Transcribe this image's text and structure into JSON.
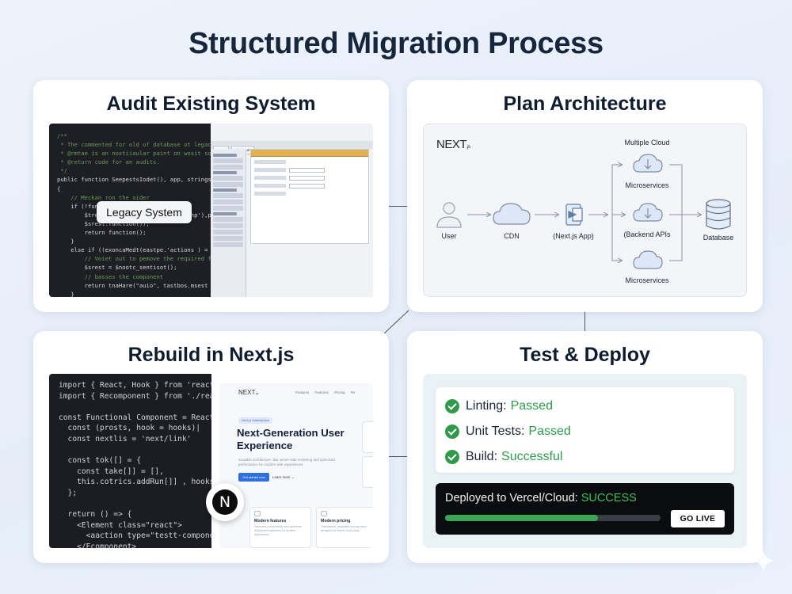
{
  "title": "Structured Migration Process",
  "panels": {
    "audit": {
      "title": "Audit Existing System",
      "code_lines": [
        "/**",
        " * The commented for old of database ot legac",
        " * @rmtae is an noxtiiaular paint on wosit sod",
        " * @return code for an audits.",
        " */",
        "public function SeepestsIodet(), app, stringst",
        "{",
        "    // Meckan ron the oider",
        "    if (!functions+$ontote')) {",
        "        $trest = $ceset_aadocese('sat_php'),pe",
        "        $srest.function());",
        "        return function();",
        "    }",
        "    else if ((exoncaMedt(eastpe.'actions ) =",
        "        // Voiet out to pemove the required fo",
        "        $srest = $nootc_sentisot();",
        "        // basses the component",
        "        return tnaHare(\"auio\", tastbos.msest",
        "    }",
        "}"
      ],
      "legacy_tabs": [
        "Home",
        "Dirsiceum"
      ],
      "legacy_label": "Legacy System"
    },
    "plan": {
      "title": "Plan Architecture",
      "logo": "NEXT",
      "logo_suffix": ".js",
      "nodes": {
        "user": "User",
        "cdn": "CDN",
        "app": "(Next.js App)",
        "cloud_group": "Multiple Cloud",
        "ms_top": "Microservices",
        "ms_mid": "(Backend APIs",
        "ms_bottom": "Microservices",
        "db": "Database"
      }
    },
    "rebuild": {
      "title": "Rebuild in Next.js",
      "code_lines": [
        "import { React, Hook } from 'react'",
        "import { Recomponent } from './reac",
        "",
        "const Functional Component = React(",
        "  const (prosts, hook = hooks)|",
        "  const nextlis = 'next/link'",
        "",
        "  const tok([] = {",
        "    const take[]] = [],",
        "    this.cotrics.addRun[]] , hooks)",
        "  };",
        "",
        "  return () => {",
        "    <Element class=\"react\">",
        "      <aaction type=\"testt-componen",
        "    </Ecomponent>"
      ],
      "badge": "N",
      "site": {
        "logo": "NEXT",
        "logo_suffix": ".js",
        "nav_links": "Features  Features  Pricing  Re",
        "pill": "Next.js Marketplace",
        "headline": "Next-Generation User Experience",
        "subtext": "Scalable architecture, fast server-side rendering and optimized performance for modern web experiences.",
        "primary_button": "Get started now",
        "secondary_button": "Learn more →",
        "cards": [
          {
            "title": "Modern features",
            "desc": "Seamless components and optimized deployment pipelines for modern applications."
          },
          {
            "title": "Modern pricing",
            "desc": "Transparent, adaptable pricing plans designed for teams of all sizes."
          }
        ]
      }
    },
    "deploy": {
      "title": "Test & Deploy",
      "checks": [
        {
          "label": "Linting:",
          "status": "Passed"
        },
        {
          "label": "Unit Tests:",
          "status": "Passed"
        },
        {
          "label": "Build:",
          "status": "Successful"
        }
      ],
      "console_text": "Deployed to Vercel/Cloud:",
      "console_status": "SUCCESS",
      "progress": 0.71,
      "button": "GO LIVE"
    }
  },
  "colors": {
    "success": "#2e9a4a",
    "title": "#16263d",
    "code_bg": "#1e1f24"
  }
}
